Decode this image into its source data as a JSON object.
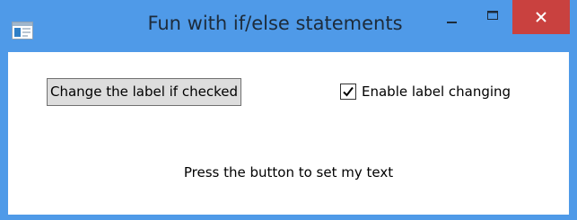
{
  "window": {
    "title": "Fun with if/else statements",
    "accent_color": "#4f9ae8",
    "close_color": "#c9413f",
    "icons": {
      "app": "window-app-icon",
      "minimize": "minimize-icon",
      "maximize": "maximize-icon",
      "close": "close-icon"
    }
  },
  "main": {
    "button_label": "Change the label if checked",
    "checkbox_label": "Enable label changing",
    "checkbox_checked": true,
    "status_text": "Press the button to set my text"
  }
}
